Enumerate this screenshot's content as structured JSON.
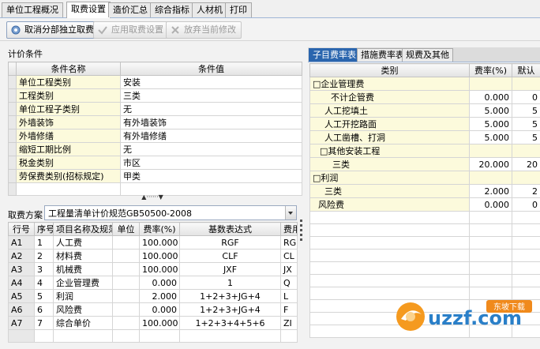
{
  "top_tabs": [
    "单位工程概况",
    "取费设置",
    "造价汇总",
    "综合指标",
    "人材机",
    "打印"
  ],
  "toolbar": {
    "btn1": "取消分部独立取费",
    "btn2": "应用取费设置",
    "btn3": "放弃当前修改"
  },
  "calc_conditions": {
    "label": "计价条件",
    "headers": [
      "条件名称",
      "条件值"
    ],
    "rows": [
      {
        "name": "单位工程类别",
        "value": "安装"
      },
      {
        "name": "工程类别",
        "value": "三类"
      },
      {
        "name": "单位工程子类别",
        "value": "无"
      },
      {
        "name": "外墙装饰",
        "value": "有外墙装饰"
      },
      {
        "name": "外墙修缮",
        "value": "有外墙修缮"
      },
      {
        "name": "缩短工期比例",
        "value": "无"
      },
      {
        "name": "税金类别",
        "value": "市区"
      },
      {
        "name": "劳保费类别(招标规定)",
        "value": "甲类"
      }
    ]
  },
  "fee_plan": {
    "label": "取费方案",
    "value": "工程量清单计价规范GB50500-2008"
  },
  "fee_table": {
    "headers": [
      "行号",
      "序号",
      "项目名称及规范",
      "单位",
      "费率(%)",
      "基数表达式",
      "费用"
    ],
    "rows": [
      {
        "code": "A1",
        "seq": "1",
        "name": "人工费",
        "unit": "",
        "rate": "100.000",
        "expr": "RGF",
        "fee": "RG"
      },
      {
        "code": "A2",
        "seq": "2",
        "name": "材料费",
        "unit": "",
        "rate": "100.000",
        "expr": "CLF",
        "fee": "CL"
      },
      {
        "code": "A3",
        "seq": "3",
        "name": "机械费",
        "unit": "",
        "rate": "100.000",
        "expr": "JXF",
        "fee": "JX"
      },
      {
        "code": "A4",
        "seq": "4",
        "name": "企业管理费",
        "unit": "",
        "rate": "0.000",
        "expr": "1",
        "fee": "Q"
      },
      {
        "code": "A5",
        "seq": "5",
        "name": "利润",
        "unit": "",
        "rate": "2.000",
        "expr": "1+2+3+JG+4",
        "fee": "L"
      },
      {
        "code": "A6",
        "seq": "6",
        "name": "风险费",
        "unit": "",
        "rate": "0.000",
        "expr": "1+2+3+JG+4",
        "fee": "F"
      },
      {
        "code": "A7",
        "seq": "7",
        "name": "综合单价",
        "unit": "",
        "rate": "100.000",
        "expr": "1+2+3+4+5+6",
        "fee": "ZI"
      }
    ]
  },
  "right_tabs": [
    "子目费率表",
    "措施费率表",
    "规费及其他"
  ],
  "rate_table": {
    "headers": [
      "类别",
      "费率(%)",
      "默认"
    ],
    "rows": [
      {
        "name": "□企业管理费",
        "rate": "",
        "def": "",
        "indent": 0,
        "cat": true
      },
      {
        "name": "不计企管费",
        "rate": "0.000",
        "def": "0",
        "indent": 2,
        "cat": false
      },
      {
        "name": "人工挖填土",
        "rate": "5.000",
        "def": "5",
        "indent": 1,
        "cat": false
      },
      {
        "name": "人工开挖路面",
        "rate": "5.000",
        "def": "5",
        "indent": 1,
        "cat": false
      },
      {
        "name": "人工凿槽、打洞",
        "rate": "5.000",
        "def": "5",
        "indent": 1,
        "cat": false
      },
      {
        "name": "□其他安装工程",
        "rate": "",
        "def": "",
        "indent": 0,
        "cat": true
      },
      {
        "name": "三类",
        "rate": "20.000",
        "def": "20",
        "indent": 2,
        "cat": false
      },
      {
        "name": "□利润",
        "rate": "",
        "def": "",
        "indent": 0,
        "cat": true
      },
      {
        "name": "三类",
        "rate": "2.000",
        "def": "2",
        "indent": 2,
        "cat": false
      },
      {
        "name": "风险费",
        "rate": "0.000",
        "def": "0",
        "indent": 0,
        "cat": false
      }
    ]
  },
  "splitter_glyph": "▲······▼",
  "watermark": {
    "text": "uzzf.com",
    "sub": "东坡下载"
  }
}
